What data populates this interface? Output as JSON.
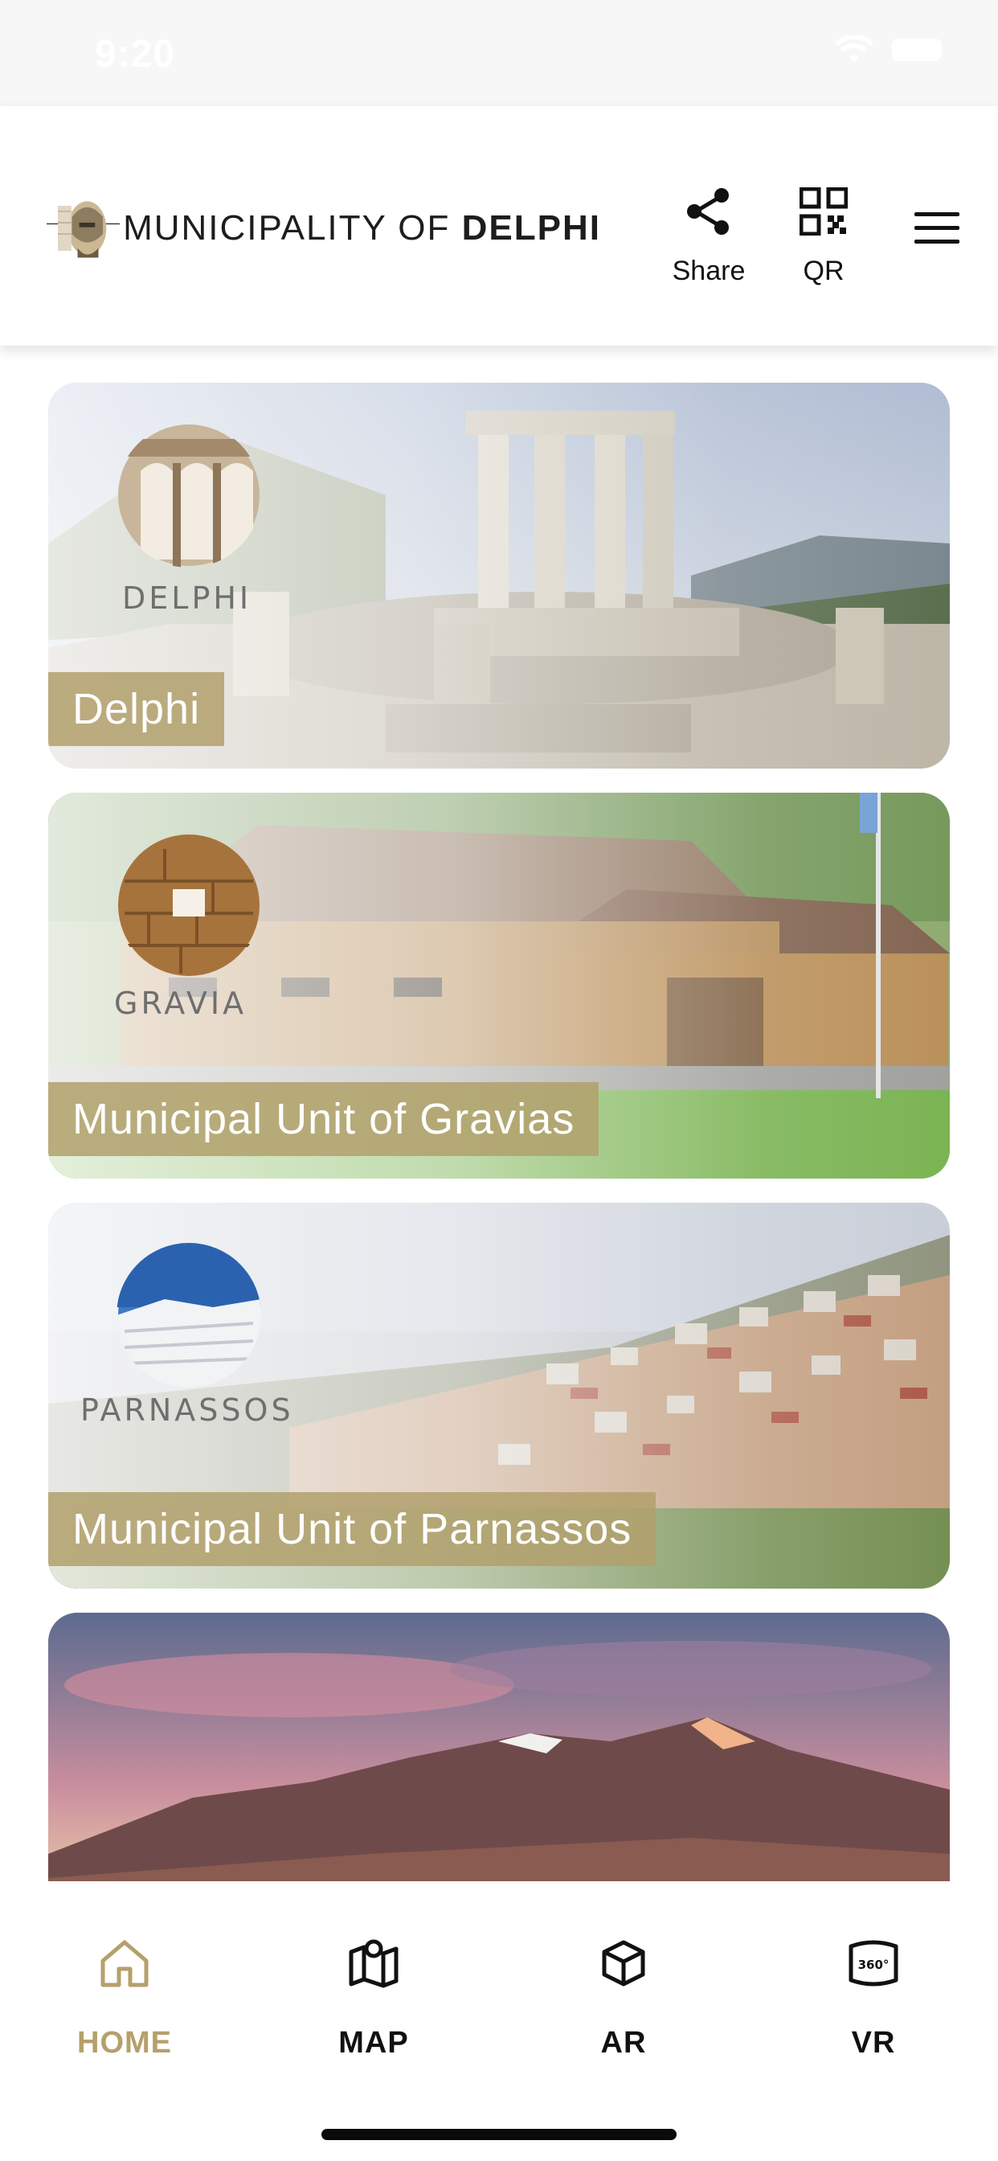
{
  "status_bar": {
    "time": "9:20"
  },
  "header": {
    "logo_text_light": "MUNICIPALITY OF ",
    "logo_text_bold": "DELPHI",
    "share_label": "Share",
    "qr_label": "QR"
  },
  "cards": [
    {
      "emblem_text": "DELPHI",
      "label": "Delphi"
    },
    {
      "emblem_text": "GRAVIA",
      "label": "Municipal Unit of Gravias"
    },
    {
      "emblem_text": "PARNASSOS",
      "label": "Municipal Unit of Parnassos"
    },
    {
      "emblem_text": "",
      "label": ""
    }
  ],
  "bottom_nav": {
    "items": [
      {
        "label": "HOME",
        "icon": "home-icon",
        "active": true
      },
      {
        "label": "MAP",
        "icon": "map-icon",
        "active": false
      },
      {
        "label": "AR",
        "icon": "cube-icon",
        "active": false
      },
      {
        "label": "VR",
        "icon": "vr-360-icon",
        "active": false
      }
    ]
  },
  "colors": {
    "accent": "#b5a06c",
    "label_bg": "#b2a06c"
  }
}
